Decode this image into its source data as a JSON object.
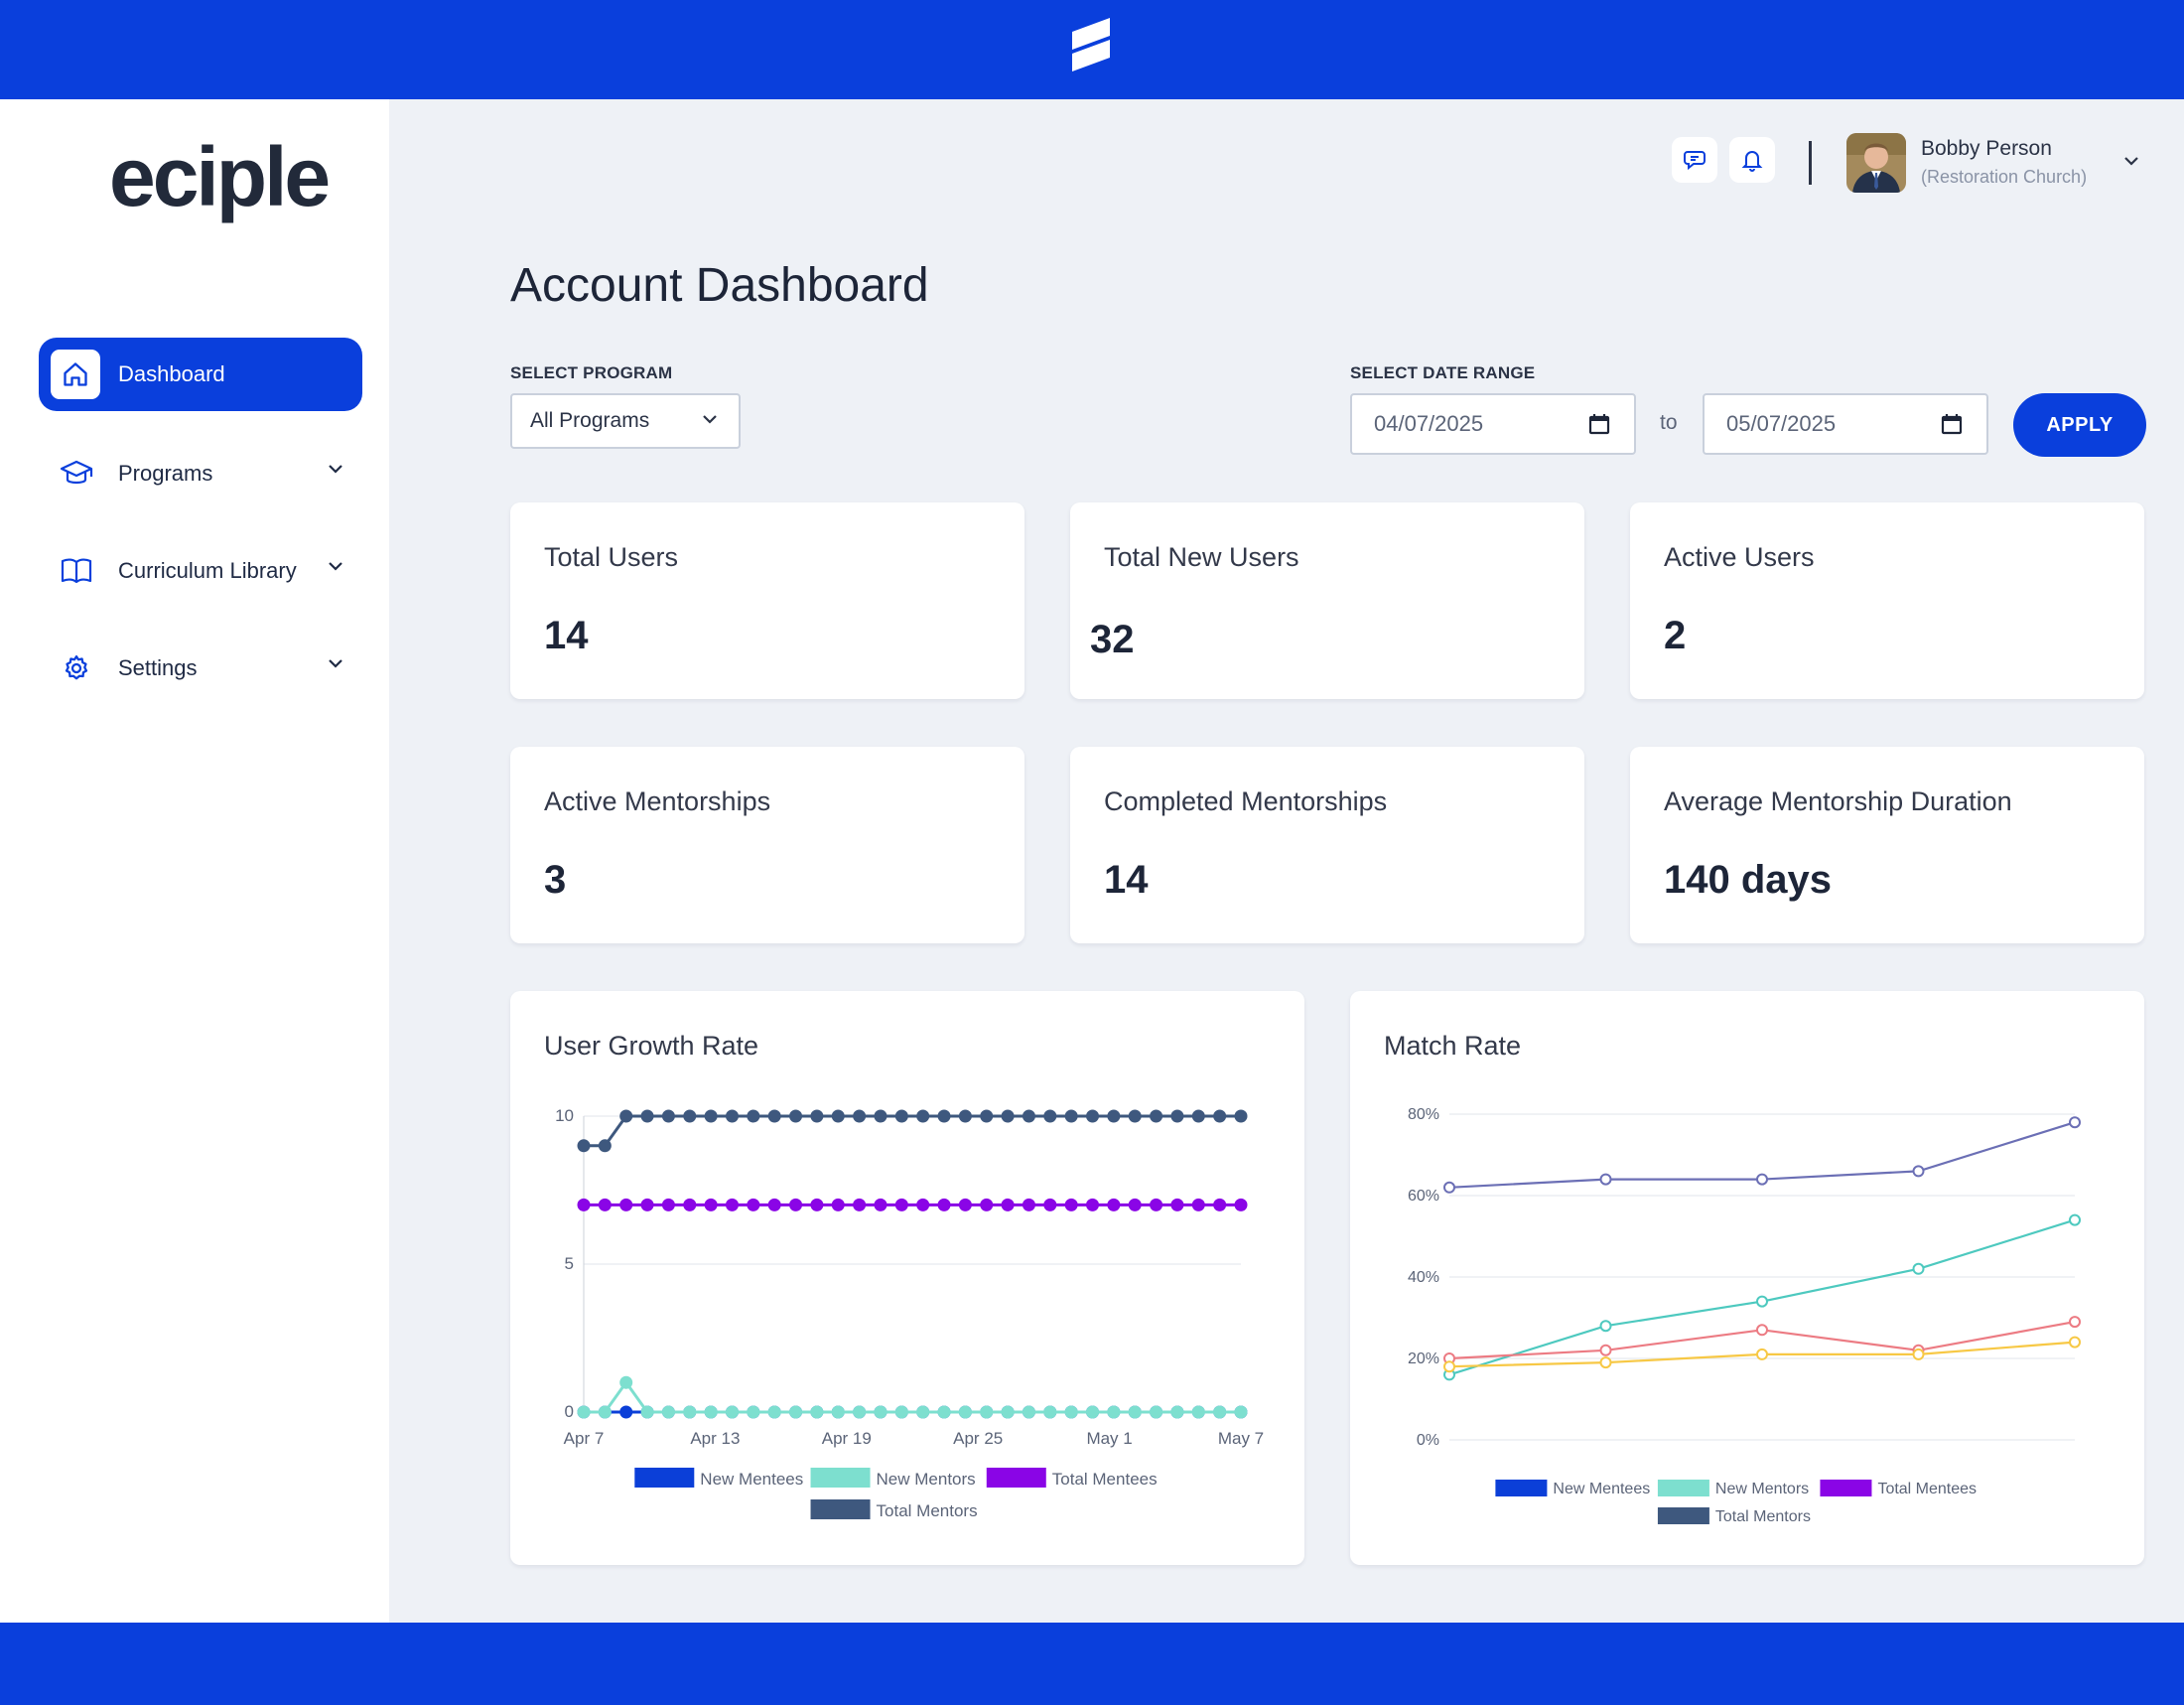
{
  "brand": {
    "logo_text": "eciple",
    "accent": "#0a3fdc"
  },
  "sidebar": {
    "items": [
      {
        "label": "Dashboard",
        "icon": "home-icon",
        "active": true
      },
      {
        "label": "Programs",
        "icon": "graduation-cap-icon",
        "active": false
      },
      {
        "label": "Curriculum Library",
        "icon": "book-icon",
        "active": false
      },
      {
        "label": "Settings",
        "icon": "gear-icon",
        "active": false
      }
    ]
  },
  "header": {
    "icons": [
      "chat-icon",
      "bell-icon"
    ],
    "user": {
      "name": "Bobby Person",
      "org": "(Restoration Church)"
    }
  },
  "page": {
    "title": "Account Dashboard"
  },
  "filters": {
    "program_label": "SELECT PROGRAM",
    "program_value": "All Programs",
    "date_label": "SELECT DATE RANGE",
    "date_from": "04/07/2025",
    "date_to": "05/07/2025",
    "to_label": "to",
    "apply_label": "APPLY"
  },
  "stats": [
    {
      "title": "Total Users",
      "value": "14"
    },
    {
      "title": "Total New Users",
      "value": "32"
    },
    {
      "title": "Active Users",
      "value": "2"
    },
    {
      "title": "Active Mentorships",
      "value": "3"
    },
    {
      "title": "Completed Mentorships",
      "value": "14"
    },
    {
      "title": "Average Mentorship Duration",
      "value": "140 days"
    }
  ],
  "chart_data": [
    {
      "type": "line",
      "title": "User Growth Rate",
      "xlabel": "",
      "ylabel": "",
      "ylim": [
        0,
        10
      ],
      "yticks": [
        "0",
        "5",
        "10"
      ],
      "xtick_labels": [
        "Apr 7",
        "Apr 13",
        "Apr 19",
        "Apr 25",
        "May 1",
        "May 7"
      ],
      "legend_position": "bottom",
      "grid": true,
      "series": [
        {
          "name": "New Mentees",
          "color": "#0b3fd8",
          "values": [
            0,
            0,
            0,
            0,
            0,
            0,
            0,
            0,
            0,
            0,
            0,
            0,
            0,
            0,
            0,
            0,
            0,
            0,
            0,
            0,
            0,
            0,
            0,
            0,
            0,
            0,
            0,
            0,
            0,
            0,
            0,
            0
          ]
        },
        {
          "name": "New Mentors",
          "color": "#7ddfcf",
          "values": [
            0,
            0,
            1,
            0,
            0,
            0,
            0,
            0,
            0,
            0,
            0,
            0,
            0,
            0,
            0,
            0,
            0,
            0,
            0,
            0,
            0,
            0,
            0,
            0,
            0,
            0,
            0,
            0,
            0,
            0,
            0,
            0
          ]
        },
        {
          "name": "Total Mentees",
          "color": "#8a05e6",
          "values": [
            7,
            7,
            7,
            7,
            7,
            7,
            7,
            7,
            7,
            7,
            7,
            7,
            7,
            7,
            7,
            7,
            7,
            7,
            7,
            7,
            7,
            7,
            7,
            7,
            7,
            7,
            7,
            7,
            7,
            7,
            7,
            7
          ]
        },
        {
          "name": "Total Mentors",
          "color": "#3e587e",
          "values": [
            9,
            9,
            10,
            10,
            10,
            10,
            10,
            10,
            10,
            10,
            10,
            10,
            10,
            10,
            10,
            10,
            10,
            10,
            10,
            10,
            10,
            10,
            10,
            10,
            10,
            10,
            10,
            10,
            10,
            10,
            10,
            10
          ]
        }
      ]
    },
    {
      "type": "line",
      "title": "Match Rate",
      "xlabel": "",
      "ylabel": "",
      "ylim": [
        0,
        80
      ],
      "yticks": [
        "0%",
        "20%",
        "40%",
        "60%",
        "80%"
      ],
      "legend_position": "bottom",
      "grid": true,
      "legend": [
        {
          "name": "New Mentees",
          "color": "#0b3fd8"
        },
        {
          "name": "New Mentors",
          "color": "#7ddfcf"
        },
        {
          "name": "Total Mentees",
          "color": "#8a05e6"
        },
        {
          "name": "Total Mentors",
          "color": "#3e587e"
        }
      ],
      "series": [
        {
          "color": "#6b6fb5",
          "values": [
            62,
            64,
            64,
            66,
            78
          ]
        },
        {
          "color": "#4dc9bf",
          "values": [
            16,
            28,
            34,
            42,
            54
          ]
        },
        {
          "color": "#ec7b83",
          "values": [
            20,
            22,
            27,
            22,
            29
          ]
        },
        {
          "color": "#f7c845",
          "values": [
            18,
            19,
            21,
            21,
            24
          ]
        }
      ]
    }
  ]
}
